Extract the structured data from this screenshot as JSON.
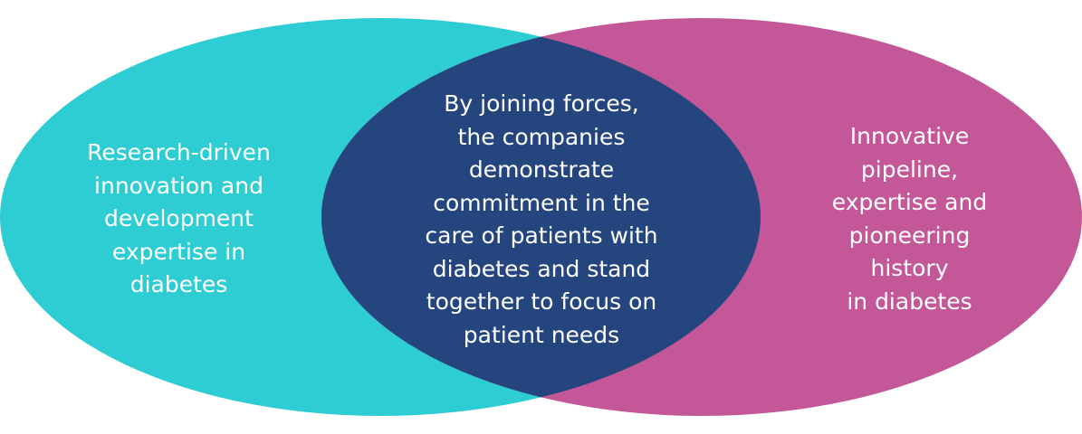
{
  "diagram": {
    "colors": {
      "left_circle": "#2ECCD3",
      "right_circle": "#C45798",
      "overlap": "#24457E",
      "text": "#FFFFFF"
    },
    "left_label": "Research-driven\ninnovation and\ndevelopment\nexpertise in\ndiabetes",
    "center_label": "By joining forces,\nthe companies\ndemonstrate\ncommitment in the\ncare of patients with\ndiabetes and stand\ntogether to focus on\npatient needs",
    "right_label": "Innovative\npipeline,\nexpertise and\npioneering\nhistory\nin diabetes"
  }
}
